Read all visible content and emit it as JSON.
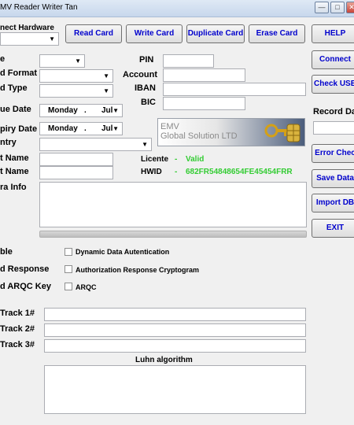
{
  "window": {
    "title": "MV Reader Writer Tan",
    "min": "—",
    "max": "□",
    "close": "✕"
  },
  "connect_hardware": {
    "label": "nect Hardware",
    "value": ""
  },
  "toolbar": {
    "read": "Read Card",
    "write": "Write Card",
    "duplicate": "Duplicate Card",
    "erase": "Erase Card",
    "help": "HELP"
  },
  "side_buttons": {
    "connect": "Connect",
    "check_usb": "Check USB",
    "record_date": "Record Da",
    "error_check": "Error Chec",
    "save_data": "Save Data",
    "import_db": "Import DB",
    "exit": "EXIT"
  },
  "form": {
    "type_label": "e",
    "card_format_label": "d Format",
    "card_type_label": "d Type",
    "issue_date_label": "ue Date",
    "expiry_date_label": "piry Date",
    "country_label": "ntry",
    "first_name_label": "t Name",
    "last_name_label": "t Name",
    "extra_info_label": "ra Info",
    "pin_label": "PIN",
    "account_label": "Account",
    "iban_label": "IBAN",
    "bic_label": "BIC",
    "issue_day": "Monday",
    "issue_sep": ".",
    "issue_month": "Jul",
    "expiry_day": "Monday",
    "expiry_sep": ".",
    "expiry_month": "Jul"
  },
  "logo": {
    "line1": "EMV",
    "line2": "Global Solution LTD"
  },
  "license": {
    "label": "Licente",
    "dash": "-",
    "value": "Valid"
  },
  "hwid": {
    "label": "HWID",
    "dash": "-",
    "value": "682FR54848654FE45454FRR"
  },
  "options": {
    "left_labels": [
      "ble",
      "d Response",
      "d ARQC Key"
    ],
    "checkboxes": [
      "Dynamic Data Autentication",
      "Authorization Response Cryptogram",
      "ARQC"
    ]
  },
  "tracks": {
    "t1": "Track 1#",
    "t2": "Track 2#",
    "t3": "Track 3#"
  },
  "luhn": {
    "label": "Luhn algorithm"
  }
}
